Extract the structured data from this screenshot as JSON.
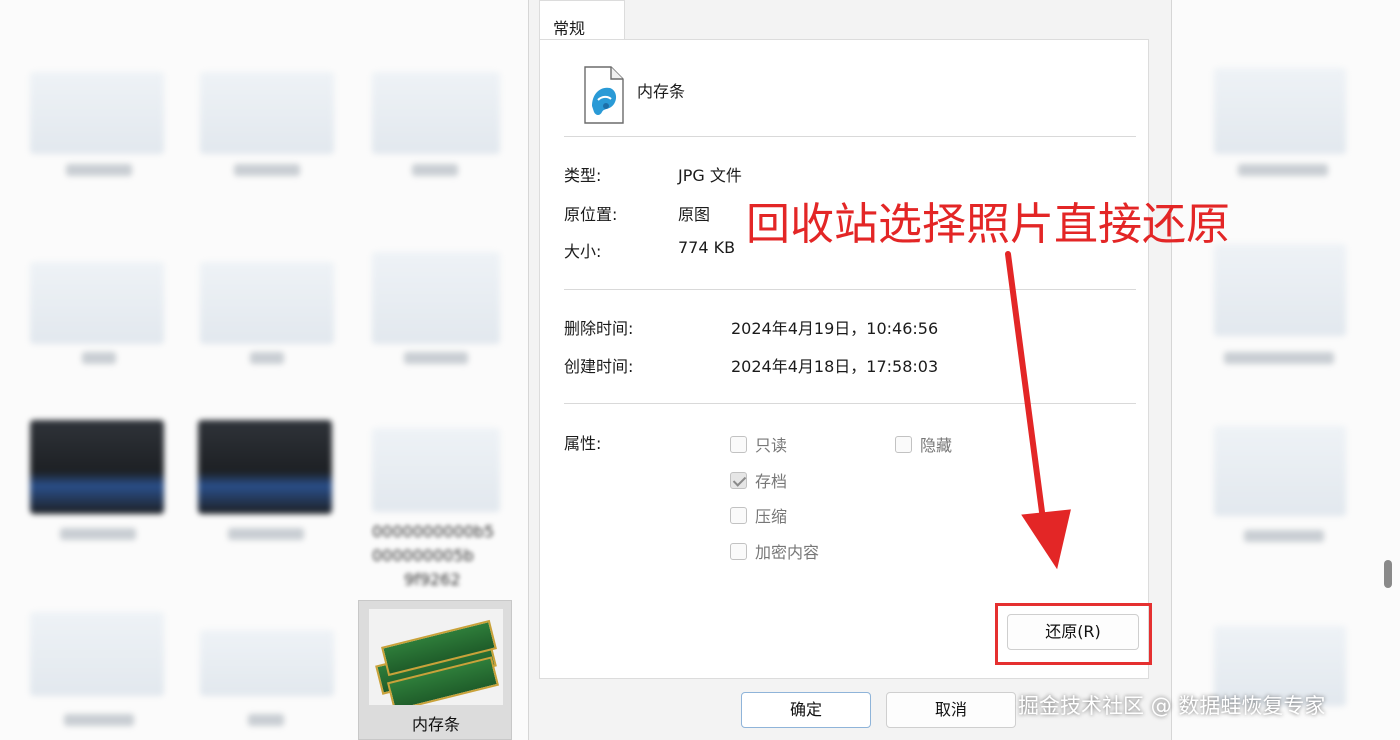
{
  "dialog": {
    "tab_general": "常规",
    "file_name": "内存条",
    "labels": {
      "type": "类型:",
      "location": "原位置:",
      "size": "大小:",
      "deleted": "删除时间:",
      "created": "创建时间:",
      "attributes": "属性:"
    },
    "values": {
      "type": "JPG 文件",
      "location": "原图",
      "size": "774 KB",
      "deleted": "2024年4月19日，10:46:56",
      "created": "2024年4月18日，17:58:03"
    },
    "attributes": {
      "readonly": {
        "label": "只读",
        "checked": false
      },
      "hidden": {
        "label": "隐藏",
        "checked": false
      },
      "archive": {
        "label": "存档",
        "checked": true
      },
      "compress": {
        "label": "压缩",
        "checked": false
      },
      "encrypt": {
        "label": "加密内容",
        "checked": false
      }
    },
    "restore_button": "还原(R)",
    "ok_button": "确定",
    "cancel_button": "取消"
  },
  "explorer": {
    "selected_file_label": "内存条",
    "blurred_captions": [
      "b5",
      "5b",
      "9f9262"
    ]
  },
  "annotation": {
    "text": "回收站选择照片直接还原",
    "color": "#e32626"
  },
  "watermark": "掘金技术社区 @ 数据蛙恢复专家",
  "icons": {
    "file": "image-file-icon",
    "arrow": "red-arrow-icon"
  }
}
